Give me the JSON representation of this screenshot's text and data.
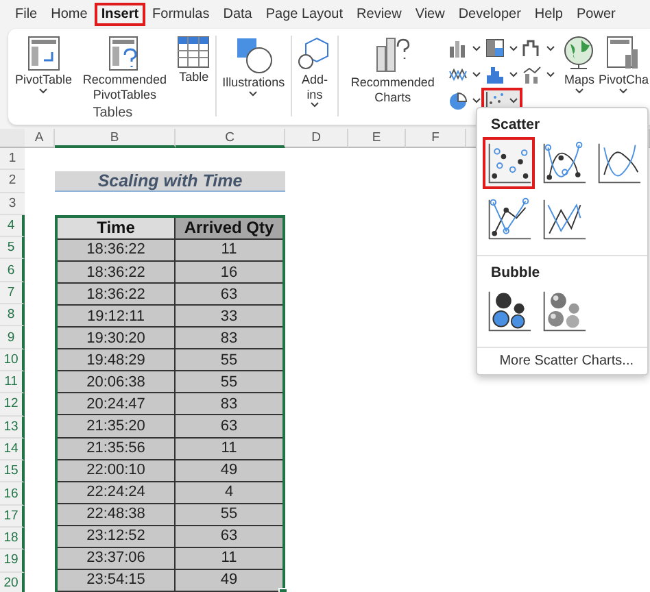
{
  "tabs": [
    {
      "label": "File",
      "selected": false
    },
    {
      "label": "Home",
      "selected": false
    },
    {
      "label": "Insert",
      "selected": true
    },
    {
      "label": "Formulas",
      "selected": false
    },
    {
      "label": "Data",
      "selected": false
    },
    {
      "label": "Page Layout",
      "selected": false
    },
    {
      "label": "Review",
      "selected": false
    },
    {
      "label": "View",
      "selected": false
    },
    {
      "label": "Developer",
      "selected": false
    },
    {
      "label": "Help",
      "selected": false
    },
    {
      "label": "Power",
      "selected": false
    }
  ],
  "ribbon": {
    "tables_group": {
      "label": "Tables",
      "buttons": [
        {
          "label": "PivotTable",
          "kind": "pivot",
          "dropdown": true
        },
        {
          "label": "Recommended PivotTables",
          "kind": "recpivot",
          "dropdown": false
        },
        {
          "label": "Table",
          "kind": "table",
          "dropdown": false
        }
      ]
    },
    "buttons": [
      {
        "label": "Illustrations",
        "kind": "illustrations",
        "dropdown": true
      },
      {
        "label": "Add-ins",
        "kind": "addins",
        "dropdown": true
      },
      {
        "label": "Recommended Charts",
        "kind": "recchart",
        "dropdown": false
      }
    ],
    "chart_buttons": [
      {
        "kind": "column",
        "selected": false
      },
      {
        "kind": "hierarchy",
        "selected": false
      },
      {
        "kind": "waterfall",
        "selected": false
      },
      {
        "kind": "line",
        "selected": false
      },
      {
        "kind": "statistic",
        "selected": false
      },
      {
        "kind": "combo",
        "selected": false
      },
      {
        "kind": "pie",
        "selected": false
      },
      {
        "kind": "scatter",
        "selected": true
      }
    ],
    "end_buttons": [
      {
        "label": "Maps",
        "kind": "maps",
        "dropdown": true
      },
      {
        "label": "PivotCha",
        "kind": "pivotchart",
        "dropdown": true
      }
    ]
  },
  "sheet": {
    "columns": [
      "A",
      "B",
      "C",
      "D",
      "E",
      "F"
    ],
    "row_numbers": [
      "1",
      "2",
      "3",
      "4",
      "5",
      "6",
      "7",
      "8",
      "9",
      "10",
      "11",
      "12",
      "13",
      "14",
      "15",
      "16",
      "17",
      "18",
      "19",
      "20"
    ],
    "title": "Scaling with Time",
    "table": {
      "columns": [
        "Time",
        "Arrived Qty"
      ],
      "rows": [
        [
          "18:36:22",
          "11"
        ],
        [
          "18:36:22",
          "16"
        ],
        [
          "18:36:22",
          "63"
        ],
        [
          "19:12:11",
          "33"
        ],
        [
          "19:30:20",
          "83"
        ],
        [
          "19:48:29",
          "55"
        ],
        [
          "20:06:38",
          "55"
        ],
        [
          "20:24:47",
          "83"
        ],
        [
          "21:35:20",
          "63"
        ],
        [
          "21:35:56",
          "11"
        ],
        [
          "22:00:10",
          "49"
        ],
        [
          "22:24:24",
          "4"
        ],
        [
          "22:48:38",
          "55"
        ],
        [
          "23:12:52",
          "63"
        ],
        [
          "23:37:06",
          "11"
        ],
        [
          "23:54:15",
          "49"
        ]
      ]
    }
  },
  "scatter_menu": {
    "sections": [
      {
        "title": "Scatter",
        "charts": [
          {
            "kind": "scatter",
            "selected": true
          },
          {
            "kind": "smooth-markers",
            "selected": false
          },
          {
            "kind": "smooth",
            "selected": false
          },
          {
            "kind": "straight-markers",
            "selected": false
          },
          {
            "kind": "straight",
            "selected": false
          }
        ]
      },
      {
        "title": "Bubble",
        "charts": [
          {
            "kind": "bubble",
            "selected": false
          },
          {
            "kind": "bubble-3d",
            "selected": false
          }
        ]
      }
    ],
    "footer": "More Scatter Charts..."
  }
}
